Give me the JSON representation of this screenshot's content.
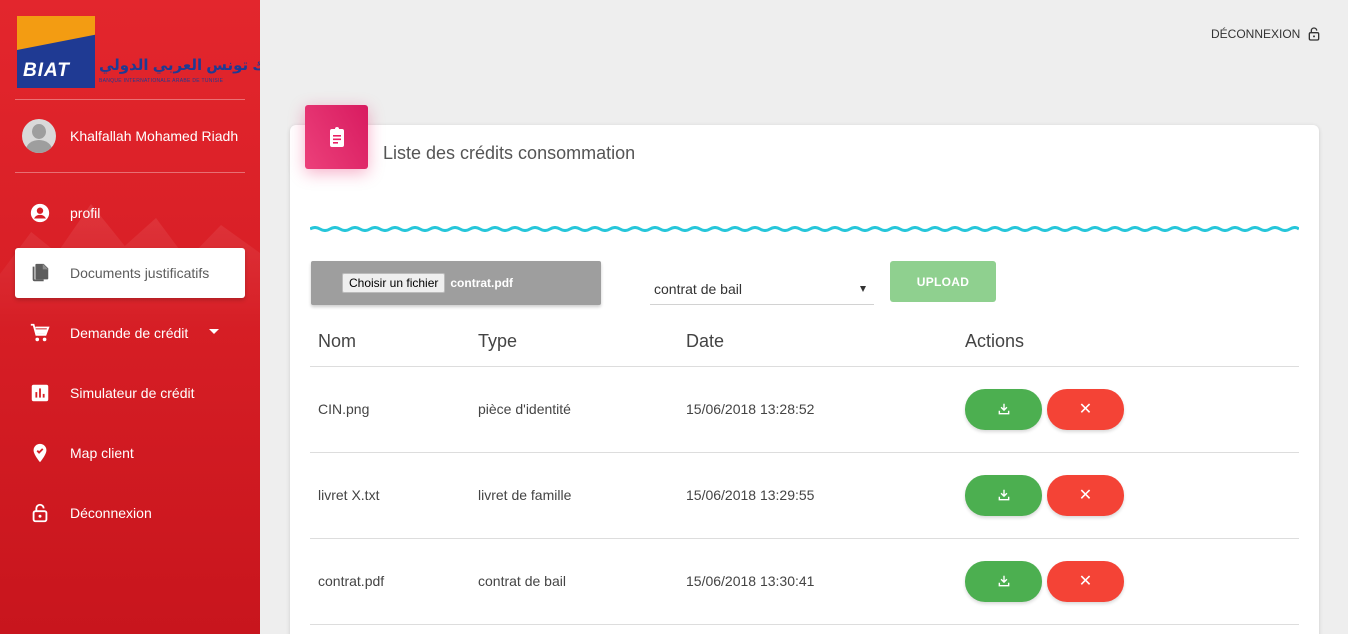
{
  "brand": {
    "name": "BIAT",
    "arabic": "بنك تونس العربي الدولي",
    "subtitle": "BANQUE INTERNATIONALE ARABE DE TUNISIE"
  },
  "user": {
    "name": "Khalfallah Mohamed Riadh"
  },
  "sidebar": {
    "items": [
      {
        "label": "profil",
        "icon": "account-circle-icon"
      },
      {
        "label": "Documents justificatifs",
        "icon": "documents-icon"
      },
      {
        "label": "Demande de crédit",
        "icon": "cart-icon"
      },
      {
        "label": "Simulateur de crédit",
        "icon": "bar-chart-icon"
      },
      {
        "label": "Map client",
        "icon": "location-check-icon"
      },
      {
        "label": "Déconnexion",
        "icon": "lock-icon"
      }
    ]
  },
  "header": {
    "logout": "DÉCONNEXION"
  },
  "card": {
    "title": "Liste des crédits consommation",
    "file_button": "Choisir un fichier",
    "file_name": "contrat.pdf",
    "select_value": "contrat de bail",
    "upload": "UPLOAD"
  },
  "table": {
    "headers": [
      "Nom",
      "Type",
      "Date",
      "Actions"
    ],
    "rows": [
      {
        "nom": "CIN.png",
        "type": "pièce d'identité",
        "date": "15/06/2018 13:28:52"
      },
      {
        "nom": "livret X.txt",
        "type": "livret de famille",
        "date": "15/06/2018 13:29:55"
      },
      {
        "nom": "contrat.pdf",
        "type": "contrat de bail",
        "date": "15/06/2018 13:30:41"
      }
    ],
    "delete_symbol": "✕"
  },
  "colors": {
    "sidebar": "#d81f26",
    "accent_pink": "#e91e63",
    "success": "#4caf50",
    "danger": "#f44336",
    "wave": "#26c6da"
  }
}
